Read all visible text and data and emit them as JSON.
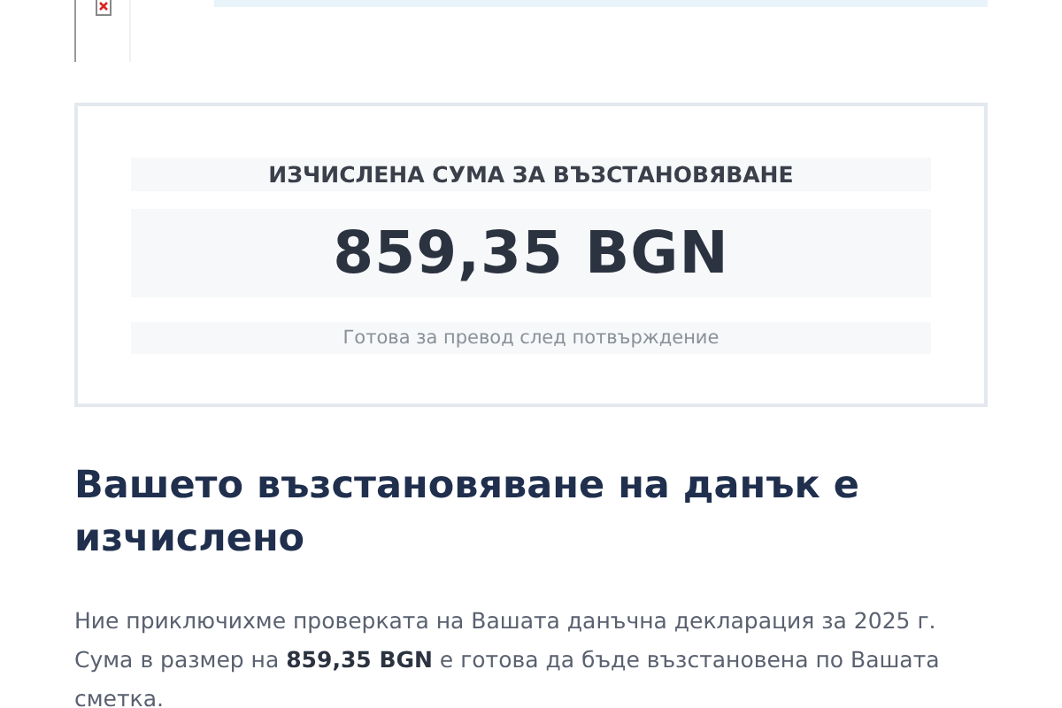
{
  "refund_card": {
    "label": "ИЗЧИСЛЕНА СУМА ЗА ВЪЗСТАНОВЯВАНЕ",
    "amount": "859,35 BGN",
    "note": "Готова за превод след потвърждение"
  },
  "heading": "Вашето възстановяване на данък е изчислено",
  "paragraph": "Ние приключихме проверката на Вашата данъчна декларация за 2025 г. Сума в размер на **859,35 BGN** е готова да бъде възстановена по Вашата сметка."
}
